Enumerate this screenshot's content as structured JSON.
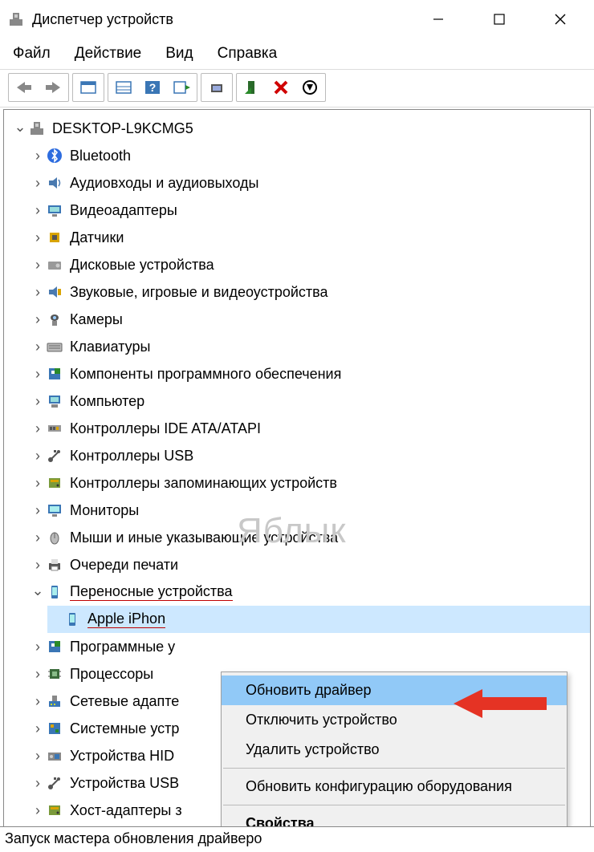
{
  "title": "Диспетчер устройств",
  "menu": {
    "file": "Файл",
    "action": "Действие",
    "view": "Вид",
    "help": "Справка"
  },
  "root": "DESKTOP-L9KCMG5",
  "watermark": "Яблык",
  "categories": [
    {
      "icon": "bluetooth",
      "label": "Bluetooth"
    },
    {
      "icon": "audio",
      "label": "Аудиовходы и аудиовыходы"
    },
    {
      "icon": "display",
      "label": "Видеоадаптеры"
    },
    {
      "icon": "sensor",
      "label": "Датчики"
    },
    {
      "icon": "disk",
      "label": "Дисковые устройства"
    },
    {
      "icon": "media",
      "label": "Звуковые, игровые и видеоустройства"
    },
    {
      "icon": "camera",
      "label": "Камеры"
    },
    {
      "icon": "keyboard",
      "label": "Клавиатуры"
    },
    {
      "icon": "software",
      "label": "Компоненты программного обеспечения"
    },
    {
      "icon": "computer",
      "label": "Компьютер"
    },
    {
      "icon": "ide",
      "label": "Контроллеры IDE ATA/ATAPI"
    },
    {
      "icon": "usb",
      "label": "Контроллеры USB"
    },
    {
      "icon": "storage",
      "label": "Контроллеры запоминающих устройств"
    },
    {
      "icon": "monitor",
      "label": "Мониторы"
    },
    {
      "icon": "mouse",
      "label": "Мыши и иные указывающие устройства"
    },
    {
      "icon": "printer",
      "label": "Очереди печати"
    }
  ],
  "expanded": {
    "icon": "portable",
    "label": "Переносные устройства",
    "child": {
      "icon": "portable",
      "label": "Apple iPhon"
    }
  },
  "after": [
    {
      "icon": "software",
      "label": "Программные у"
    },
    {
      "icon": "cpu",
      "label": "Процессоры"
    },
    {
      "icon": "network",
      "label": "Сетевые адапте"
    },
    {
      "icon": "system",
      "label": "Системные устр"
    },
    {
      "icon": "hid",
      "label": "Устройства HID"
    },
    {
      "icon": "usb",
      "label": "Устройства USB"
    },
    {
      "icon": "storage",
      "label": "Хост-адаптеры з"
    }
  ],
  "ctx": {
    "update": "Обновить драйвер",
    "disable": "Отключить устройство",
    "remove": "Удалить устройство",
    "scan": "Обновить конфигурацию оборудования",
    "props": "Свойства"
  },
  "status": "Запуск мастера обновления драйверо"
}
